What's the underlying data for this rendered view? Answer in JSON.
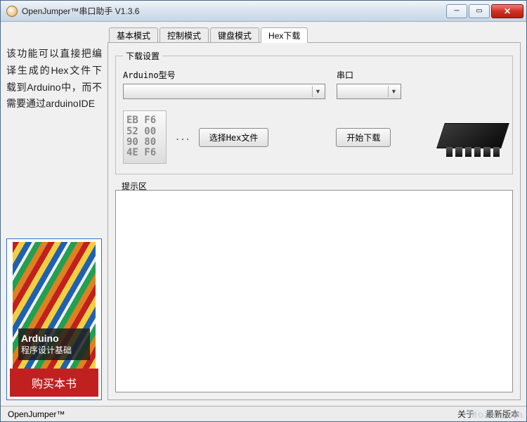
{
  "window": {
    "title": "OpenJumper™串口助手  V1.3.6"
  },
  "sidebar": {
    "description": "该功能可以直接把编译生成的Hex文件下载到Arduino中，而不需要通过arduinoIDE",
    "book": {
      "title_line1": "Arduino",
      "title_line2": "程序设计基础",
      "buy_label": "购买本书"
    }
  },
  "tabs": [
    {
      "label": "基本模式"
    },
    {
      "label": "控制模式"
    },
    {
      "label": "键盘模式"
    },
    {
      "label": "Hex下载"
    }
  ],
  "active_tab_index": 3,
  "download": {
    "group_title": "下载设置",
    "arduino_label": "Arduino型号",
    "port_label": "串口",
    "hex_preview": "EB F6\n52 00\n90 80\n4E F6",
    "dots": "...",
    "select_hex_btn": "选择Hex文件",
    "start_btn": "开始下载",
    "output_label": "提示区"
  },
  "statusbar": {
    "brand": "OpenJumper™",
    "about": "关于",
    "latest": "最新版本"
  },
  "watermark": "MoZu.com"
}
